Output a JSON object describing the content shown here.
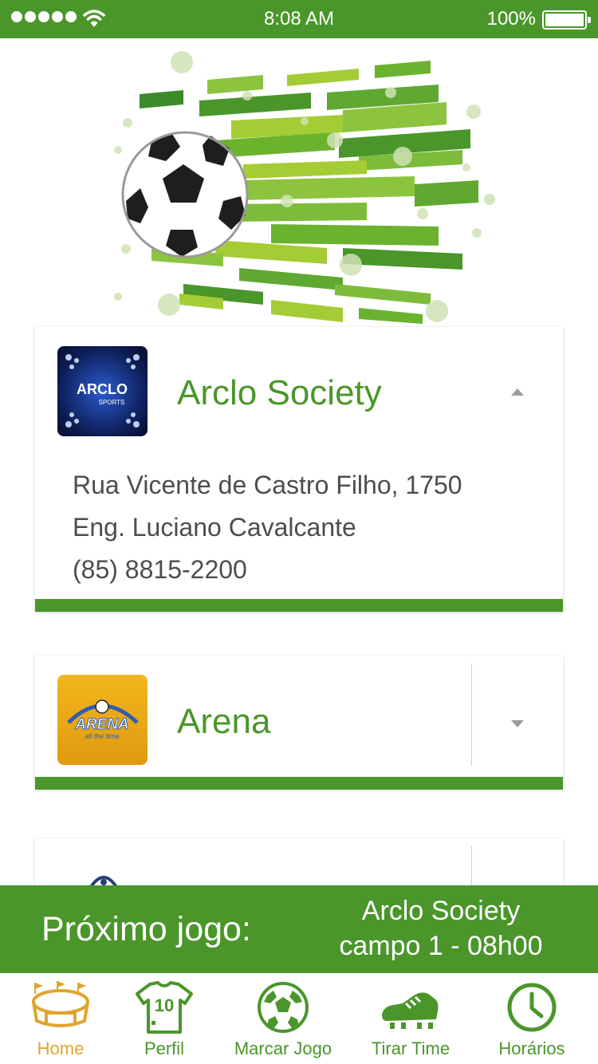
{
  "status_bar": {
    "time": "8:08 AM",
    "battery": "100%"
  },
  "venues": [
    {
      "name": "Arclo Society",
      "logo_text": "ARCLO",
      "logo_subtext": "SPORTS",
      "expanded": true,
      "address_line1": "Rua Vicente de Castro Filho, 1750",
      "address_line2": "Eng. Luciano Cavalcante",
      "phone": "(85) 8815-2200"
    },
    {
      "name": "Arena",
      "logo_text": "ARENA",
      "logo_subtext": "all the time",
      "expanded": false
    }
  ],
  "next_match": {
    "label": "Próximo jogo:",
    "venue": "Arclo Society",
    "detail": "campo 1 - 08h00"
  },
  "nav": [
    {
      "label": "Home",
      "icon": "stadium-icon",
      "active": true
    },
    {
      "label": "Perfil",
      "icon": "jersey-icon",
      "jersey_number": "10"
    },
    {
      "label": "Marcar Jogo",
      "icon": "soccer-ball-icon"
    },
    {
      "label": "Tirar Time",
      "icon": "cleat-icon"
    },
    {
      "label": "Horários",
      "icon": "clock-icon"
    }
  ],
  "colors": {
    "primary_green": "#4a962a",
    "active_gold": "#e0a52e",
    "text_gray": "#4d4d4d"
  }
}
